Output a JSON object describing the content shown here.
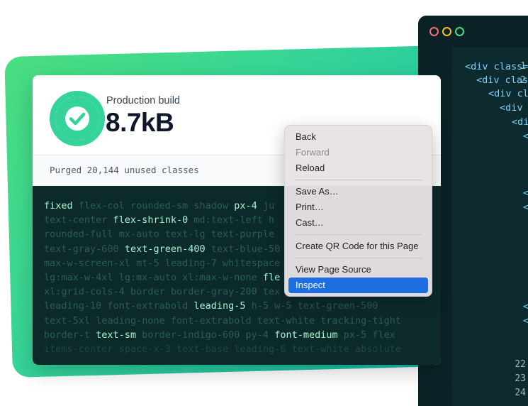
{
  "build": {
    "label": "Production build",
    "size": "8.7kB",
    "purged": "Purged 20,144 unused classes"
  },
  "classes": [
    [
      {
        "t": "fixed",
        "on": true
      },
      {
        "t": "flex-col",
        "on": false
      },
      {
        "t": "rounded-sm",
        "on": false
      },
      {
        "t": "shadow",
        "on": false
      },
      {
        "t": "px-4",
        "on": true
      },
      {
        "t": "ju",
        "on": false
      }
    ],
    [
      {
        "t": "text-center",
        "on": false
      },
      {
        "t": "flex-shrink-0",
        "on": true
      },
      {
        "t": "md:text-left",
        "on": false
      },
      {
        "t": "h",
        "on": false
      }
    ],
    [
      {
        "t": "rounded-full",
        "on": false
      },
      {
        "t": "mx-auto",
        "on": false
      },
      {
        "t": "text-lg",
        "on": false
      },
      {
        "t": "text-purple",
        "on": false
      }
    ],
    [
      {
        "t": "text-gray-600",
        "on": false
      },
      {
        "t": "text-green-400",
        "on": true
      },
      {
        "t": "text-blue-50",
        "on": false
      }
    ],
    [
      {
        "t": "max-w-screen-xl",
        "on": false
      },
      {
        "t": "mt-5",
        "on": false
      },
      {
        "t": "leading-7",
        "on": false
      },
      {
        "t": "whitespace",
        "on": false
      }
    ],
    [
      {
        "t": "lg:max-w-4xl",
        "on": false
      },
      {
        "t": "lg:mx-auto",
        "on": false
      },
      {
        "t": "xl:max-w-none",
        "on": false
      },
      {
        "t": "fle",
        "on": true
      }
    ],
    [
      {
        "t": "xl:grid-cols-4",
        "on": false
      },
      {
        "t": "border",
        "on": false
      },
      {
        "t": "border-gray-200",
        "on": false
      },
      {
        "t": "tex",
        "on": false
      }
    ],
    [
      {
        "t": "leading-10",
        "on": false
      },
      {
        "t": "font-extrabold",
        "on": false
      },
      {
        "t": "leading-5",
        "on": true
      },
      {
        "t": "h-5",
        "on": false
      },
      {
        "t": "w-5",
        "on": false
      },
      {
        "t": "text-green-500",
        "on": false
      }
    ],
    [
      {
        "t": "text-5xl",
        "on": false
      },
      {
        "t": "leading-none",
        "on": false
      },
      {
        "t": "font-extrabold",
        "on": false
      },
      {
        "t": "text-white",
        "on": false
      },
      {
        "t": "tracking-tight",
        "on": false
      }
    ],
    [
      {
        "t": "border-t",
        "on": false
      },
      {
        "t": "text-sm",
        "on": true
      },
      {
        "t": "border-indigo-600",
        "on": false
      },
      {
        "t": "py-4",
        "on": false
      },
      {
        "t": "font-medium",
        "on": true
      },
      {
        "t": "px-5",
        "on": false
      },
      {
        "t": "flex",
        "on": false
      }
    ],
    [
      {
        "t": "items-center",
        "on": false,
        "fade": true
      },
      {
        "t": "space-x-3",
        "on": false,
        "fade": true
      },
      {
        "t": "text-base",
        "on": false,
        "fade": true
      },
      {
        "t": "leading-6",
        "on": false,
        "fade": true
      },
      {
        "t": "text-white",
        "on": false,
        "fade": true
      },
      {
        "t": "absolute",
        "on": false,
        "fade": true
      }
    ]
  ],
  "menu": {
    "back": "Back",
    "forward": "Forward",
    "reload": "Reload",
    "save_as": "Save As…",
    "print": "Print…",
    "cast": "Cast…",
    "qr": "Create QR Code for this Page",
    "view_source": "View Page Source",
    "inspect": "Inspect"
  },
  "editor": {
    "line_numbers": [
      "1",
      "2",
      "22",
      "23",
      "24"
    ],
    "code": [
      "<div class=",
      "<div clas",
      "<div cl",
      "<div",
      "<di",
      "<",
      "<",
      "<",
      "<",
      "<"
    ]
  },
  "colors": {
    "accent_green": "#34d399",
    "inspect_highlight": "#1d6ee0"
  }
}
